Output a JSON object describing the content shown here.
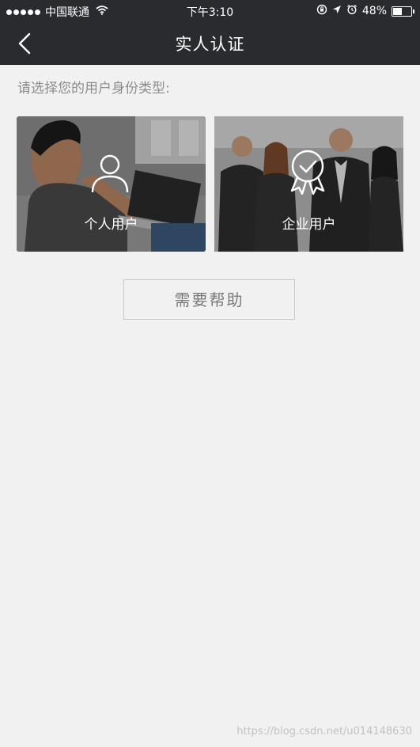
{
  "status_bar": {
    "carrier": "中国联通",
    "time": "下午3:10",
    "battery": "48%",
    "battery_level": 0.48
  },
  "nav": {
    "title": "实人认证",
    "back_icon": "chevron-left-icon"
  },
  "prompt": "请选择您的用户身份类型:",
  "options": [
    {
      "label": "个人用户",
      "icon": "person-icon"
    },
    {
      "label": "企业用户",
      "icon": "badge-check-icon"
    }
  ],
  "help_button": "需要帮助",
  "watermark": "https://blog.csdn.net/u014148630",
  "colors": {
    "nav_bg": "#2a2b2e",
    "page_bg": "#f1f1f1",
    "prompt_text": "#8c8c8c",
    "button_border": "#c7c7c7"
  }
}
